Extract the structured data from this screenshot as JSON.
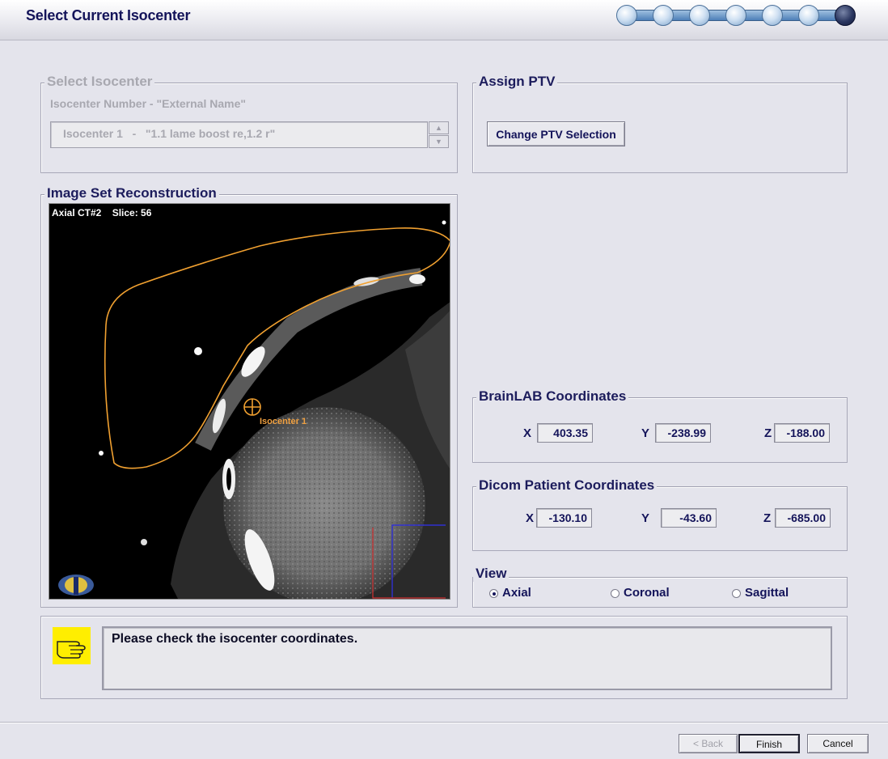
{
  "header": {
    "title": "Select Current Isocenter",
    "progress": {
      "total_steps": 7,
      "current_step": 7
    }
  },
  "select_isocenter": {
    "legend": "Select Isocenter",
    "caption": "Isocenter Number - \"External Name\"",
    "value": "Isocenter 1   -   \"1.1 lame boost re,1.2 r\""
  },
  "assign_ptv": {
    "legend": "Assign PTV",
    "button_label": "Change PTV Selection"
  },
  "image_set": {
    "legend": "Image Set Reconstruction",
    "view_label": "Axial CT#2    Slice: 56",
    "isocenter_label": "Isocenter 1"
  },
  "brainlab": {
    "legend": "BrainLAB Coordinates",
    "x_label": "X",
    "x": "403.35",
    "y_label": "Y",
    "y": "-238.99",
    "z_label": "Z",
    "z": "-188.00"
  },
  "dicom": {
    "legend": "Dicom Patient Coordinates",
    "x_label": "X",
    "x": "-130.10",
    "y_label": "Y",
    "y": "-43.60",
    "z_label": "Z",
    "z": "-685.00"
  },
  "view": {
    "legend": "View",
    "options": [
      "Axial",
      "Coronal",
      "Sagittal"
    ],
    "selected": "Axial"
  },
  "message": {
    "text": "Please check the isocenter coordinates.",
    "icon": "pointing-hand-icon"
  },
  "footer": {
    "back_label": "< Back",
    "finish_label": "Finish",
    "cancel_label": "Cancel"
  },
  "colors": {
    "header_title": "#14145a",
    "contour": "#f0a030",
    "background": "#e4e4ec",
    "message_icon_bg": "#ffee00"
  }
}
